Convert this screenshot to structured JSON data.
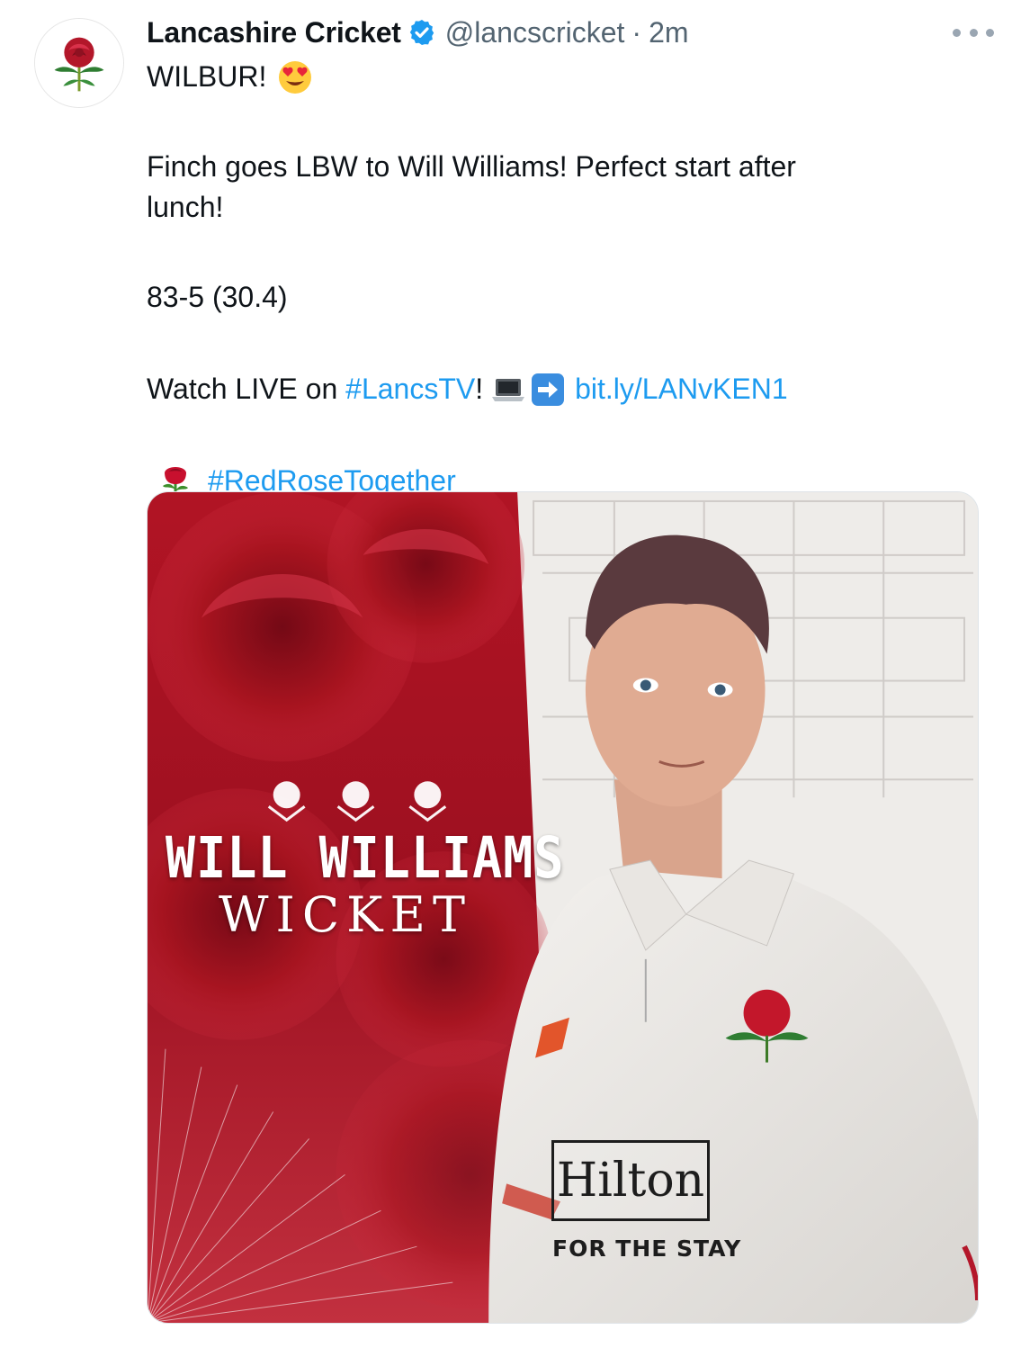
{
  "tweet": {
    "author_name": "Lancashire Cricket",
    "handle": "@lancscricket",
    "separator": "·",
    "time": "2m",
    "lines": {
      "l1": "WILBUR!",
      "l2": "Finch goes LBW to Will Williams! Perfect start after",
      "l3": "lunch!",
      "l4": "83-5 (30.4)",
      "l5_prefix": "Watch LIVE on ",
      "l5_hashtag": "#LancsTV",
      "l5_bang": "!",
      "l5_link": "bit.ly/LANvKEN1",
      "l6_hashtag": "#RedRoseTogether"
    },
    "icons": [
      "verified-badge-icon",
      "heart-eyes-emoji",
      "laptop-emoji",
      "right-arrow-emoji",
      "rose-emoji",
      "more-options-icon"
    ]
  },
  "graphic": {
    "line1": "WILL WILLIAMS",
    "line2": "WICKET",
    "sponsor_name": "Hilton",
    "sponsor_tagline": "FOR THE STAY"
  },
  "colors": {
    "link": "#1d9bf0",
    "text": "#0f1419",
    "muted": "#536471",
    "rose_red": "#b3172a"
  }
}
